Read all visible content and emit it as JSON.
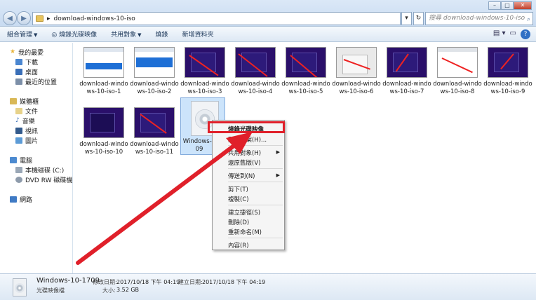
{
  "address": {
    "path": "download-windows-10-iso",
    "arrow": "▸"
  },
  "search": {
    "placeholder": "搜尋 download-windows-10-iso"
  },
  "toolbar": {
    "organize": "組合管理",
    "burn_image": "燒錄光碟映像",
    "share": "共用對象",
    "burn": "燒錄",
    "new_folder": "新增資料夾"
  },
  "sidebar": {
    "favorites": "我的最愛",
    "downloads": "下載",
    "desktop": "桌面",
    "recent": "最近的位置",
    "libraries": "媒體櫃",
    "documents": "文件",
    "music": "音樂",
    "videos": "視訊",
    "pictures": "圖片",
    "computer": "電腦",
    "local_disk": "本機磁碟 (C:)",
    "dvd": "DVD RW 磁碟機 (E:",
    "network": "網路"
  },
  "files": [
    "download-windows-10-iso-1",
    "download-windows-10-iso-2",
    "download-windows-10-iso-3",
    "download-windows-10-iso-4",
    "download-windows-10-iso-5",
    "download-windows-10-iso-6",
    "download-windows-10-iso-7",
    "download-windows-10-iso-8",
    "download-windows-10-iso-9",
    "download-windows-10-iso-10",
    "download-windows-10-iso-11"
  ],
  "iso_file": {
    "label": "Windows-1",
    "label2": "09"
  },
  "context_menu": {
    "burn_image": "燒錄光碟映像",
    "open_with": "開啟檔案(H)...",
    "share": "共用對象(H)",
    "restore": "還原舊版(V)",
    "send_to": "傳送到(N)",
    "cut": "剪下(T)",
    "copy": "複製(C)",
    "create_shortcut": "建立捷徑(S)",
    "delete": "刪除(D)",
    "rename": "重新命名(M)",
    "properties": "內容(R)"
  },
  "details": {
    "name": "Windows-10-1709",
    "type": "光碟映像檔",
    "modified_label": "修改日期:",
    "modified": "2017/10/18 下午 04:19",
    "created_label": "建立日期:",
    "created": "2017/10/18 下午 04:19",
    "size_label": "大小:",
    "size": "3.52 GB"
  },
  "colors": {
    "highlight": "#e0202a",
    "arrow": "#e0202a",
    "selection": "#cce4fb"
  }
}
